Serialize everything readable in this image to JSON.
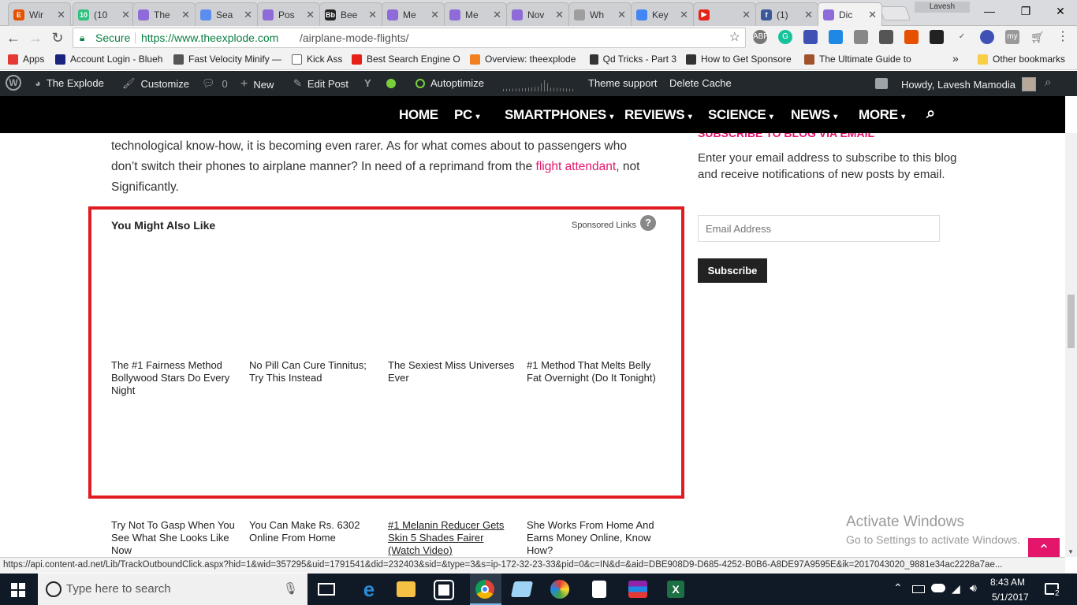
{
  "browser": {
    "tabs": [
      {
        "label": "Wir",
        "fav_color": "#e65100",
        "fav_glyph": "E"
      },
      {
        "label": "(10",
        "fav_color": "#2ec27e",
        "fav_glyph": "10"
      },
      {
        "label": "The",
        "fav_color": "#8e6bd8",
        "fav_glyph": ""
      },
      {
        "label": "Sea",
        "fav_color": "#5b8def",
        "fav_glyph": ""
      },
      {
        "label": "Pos",
        "fav_color": "#8e6bd8",
        "fav_glyph": ""
      },
      {
        "label": "Bee",
        "fav_color": "#222222",
        "fav_glyph": "Bb"
      },
      {
        "label": "Me",
        "fav_color": "#8e6bd8",
        "fav_glyph": ""
      },
      {
        "label": "Me",
        "fav_color": "#8e6bd8",
        "fav_glyph": ""
      },
      {
        "label": "Nov",
        "fav_color": "#8e6bd8",
        "fav_glyph": ""
      },
      {
        "label": "Wh",
        "fav_color": "#9e9e9e",
        "fav_glyph": ""
      },
      {
        "label": "Key",
        "fav_color": "#4285f4",
        "fav_glyph": ""
      },
      {
        "label": "",
        "fav_color": "#e62117",
        "fav_glyph": "▶"
      },
      {
        "label": "(1)",
        "fav_color": "#3b5998",
        "fav_glyph": "f"
      },
      {
        "label": "Dic",
        "fav_color": "#8e6bd8",
        "fav_glyph": ""
      }
    ],
    "profile_name": "Lavesh",
    "secure_label": "Secure",
    "url": "https://www.theexplode.com/airplane-mode-flights/",
    "url_host": "https://www.theexplode.com",
    "url_path": "/airplane-mode-flights/",
    "bookmarks": [
      {
        "label": "Apps",
        "color": "#e53935"
      },
      {
        "label": "Account Login - Blueh",
        "color": "#1a237e"
      },
      {
        "label": "Fast Velocity Minify —",
        "color": "#555555"
      },
      {
        "label": "Kick Ass",
        "color": "#ffffff"
      },
      {
        "label": "Best Search Engine O",
        "color": "#e62117"
      },
      {
        "label": "Overview: theexplode",
        "color": "#f38020"
      },
      {
        "label": "Qd Tricks - Part 3",
        "color": "#333333"
      },
      {
        "label": "How to Get Sponsore",
        "color": "#333333"
      },
      {
        "label": "The Ultimate Guide to",
        "color": "#a0522d"
      }
    ],
    "bookmarks_more": "»",
    "other_bookmarks": "Other bookmarks",
    "status_url": "https://api.content-ad.net/Lib/TrackOutboundClick.aspx?hid=1&wid=357295&uid=1791541&did=232403&sid=&type=3&s=ip-172-32-23-33&pid=0&c=IN&d=&aid=DBE908D9-D685-4252-B0B6-A8DE97A9595E&ik=2017043020_9881e34ac2228a7ae..."
  },
  "adminbar": {
    "site_name": "The Explode",
    "customize": "Customize",
    "comments_count": "0",
    "new_label": "New",
    "edit_post": "Edit Post",
    "autoptimize": "Autoptimize",
    "theme_support": "Theme support",
    "delete_cache": "Delete Cache",
    "howdy": "Howdy, Lavesh Mamodia"
  },
  "sitenav": {
    "items": [
      "HOME",
      "PC",
      "SMARTPHONES",
      "REVIEWS",
      "SCIENCE",
      "NEWS",
      "MORE"
    ]
  },
  "article": {
    "para_part1": "technological know-how, it is becoming even rarer. As for what comes about to passengers who don’t switch their phones to airplane manner? In need of a reprimand from the ",
    "link_text": "flight attendant",
    "para_part2": ", not Significantly."
  },
  "ads": {
    "heading": "You Might Also Like",
    "sponsored": "Sponsored Links",
    "help_glyph": "?",
    "row1": [
      "The #1 Fairness Method Bollywood Stars Do Every Night",
      "No Pill Can Cure Tinnitus; Try This Instead",
      "The Sexiest Miss Universes Ever",
      "#1 Method That Melts Belly Fat Overnight (Do It Tonight)"
    ],
    "row2": [
      "Try Not To Gasp When You See What She Looks Like Now",
      "You Can Make Rs. 6302 Online From Home",
      "#1 Melanin Reducer Gets Skin 5 Shades Fairer (Watch Video)",
      "She Works From Home And Earns Money Online, Know How?"
    ]
  },
  "sidebar": {
    "heading_partial": "SUBSCRIBE TO BLOG VIA EMAIL",
    "text": "Enter your email address to subscribe to this blog and receive notifications of new posts by email.",
    "email_placeholder": "Email Address",
    "subscribe_button": "Subscribe"
  },
  "watermark": {
    "title": "Activate Windows",
    "subtitle": "Go to Settings to activate Windows."
  },
  "taskbar": {
    "search_placeholder": "Type here to search",
    "time": "8:43 AM",
    "date": "5/1/2017",
    "notif_count": "2"
  }
}
